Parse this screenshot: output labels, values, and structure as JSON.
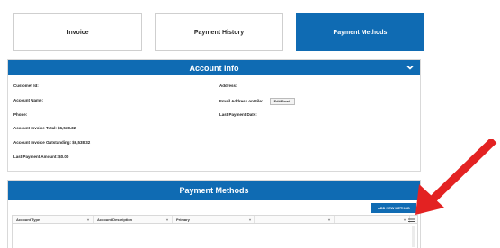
{
  "tabs": [
    {
      "label": "Invoice"
    },
    {
      "label": "Payment History"
    },
    {
      "label": "Payment Methods"
    }
  ],
  "active_tab": "Payment Methods",
  "account_info": {
    "title": "Account Info",
    "customer_id_label": "Customer Id:",
    "account_name_label": "Account Name:",
    "phone_label": "Phone:",
    "invoice_total_label": "Account Invoice Total: $6,538.32",
    "invoice_outstanding_label": "Account Invoice Outstanding: $6,538.32",
    "last_payment_amount_label": "Last Payment Amount: $0.00",
    "address_label": "Address:",
    "email_label": "Email Address on File:",
    "edit_email_label": "Edit Email",
    "last_payment_date_label": "Last Payment Date:"
  },
  "payment_methods": {
    "title": "Payment Methods",
    "add_button_label": "ADD NEW METHOD",
    "columns": [
      "Account Type",
      "Account Description",
      "Primary",
      "",
      ""
    ]
  },
  "colors": {
    "primary": "#0f6bb3",
    "annotation_arrow": "#e32222"
  },
  "icons": [
    "chevron-down-icon",
    "column-menu-icon",
    "annotation-arrow"
  ]
}
